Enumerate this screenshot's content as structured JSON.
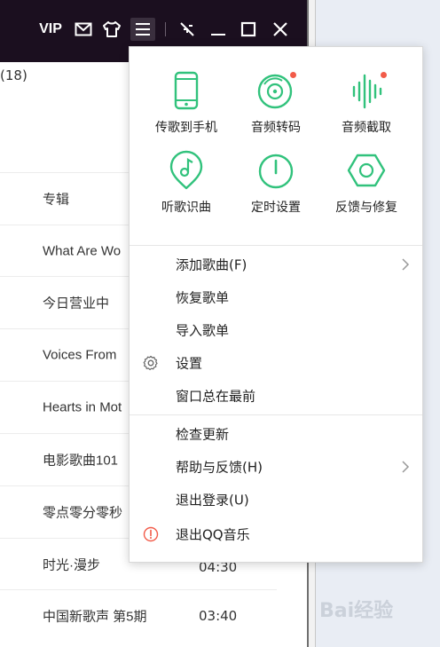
{
  "titlebar": {
    "vip_label": "VIP",
    "icons": [
      "mail-icon",
      "skin-icon",
      "menu-icon",
      "mini-mode-icon",
      "minimize-icon",
      "maximize-icon",
      "close-icon"
    ]
  },
  "list": {
    "count": "(18)",
    "rows": [
      {
        "album": "专辑",
        "duration": ""
      },
      {
        "album": "What Are Wo",
        "duration": ""
      },
      {
        "album": "今日营业中",
        "duration": ""
      },
      {
        "album": "Voices From",
        "duration": ""
      },
      {
        "album": "Hearts in Mot",
        "duration": ""
      },
      {
        "album": "电影歌曲101",
        "duration": ""
      },
      {
        "album": "零点零分零秒",
        "duration": ""
      },
      {
        "album": "时光·漫步",
        "duration": "04:30"
      },
      {
        "album": "中国新歌声 第5期",
        "duration": "03:40"
      }
    ]
  },
  "menu": {
    "grid": [
      {
        "label": "传歌到手机",
        "icon": "phone-icon",
        "dot": false
      },
      {
        "label": "音频转码",
        "icon": "disc-convert-icon",
        "dot": true
      },
      {
        "label": "音频截取",
        "icon": "waveform-icon",
        "dot": true
      },
      {
        "label": "听歌识曲",
        "icon": "music-recognize-icon",
        "dot": false
      },
      {
        "label": "定时设置",
        "icon": "power-timer-icon",
        "dot": false
      },
      {
        "label": "反馈与修复",
        "icon": "hexagon-repair-icon",
        "dot": false
      }
    ],
    "items": [
      {
        "label": "添加歌曲(F)",
        "submenu": true,
        "icon": ""
      },
      {
        "label": "恢复歌单",
        "submenu": false,
        "icon": ""
      },
      {
        "label": "导入歌单",
        "submenu": false,
        "icon": ""
      },
      {
        "label": "设置",
        "submenu": false,
        "icon": "gear-icon"
      },
      {
        "label": "窗口总在最前",
        "submenu": false,
        "icon": ""
      },
      {
        "label": "检查更新",
        "submenu": false,
        "icon": ""
      },
      {
        "label": "帮助与反馈(H)",
        "submenu": true,
        "icon": ""
      },
      {
        "label": "退出登录(U)",
        "submenu": false,
        "icon": ""
      },
      {
        "label": "退出QQ音乐",
        "submenu": false,
        "icon": "exit-alert-icon"
      }
    ]
  },
  "watermark": "Bai经验",
  "colors": {
    "accent": "#31c27c",
    "dot": "#f25b49",
    "titlebar": "#1b0f1f"
  }
}
